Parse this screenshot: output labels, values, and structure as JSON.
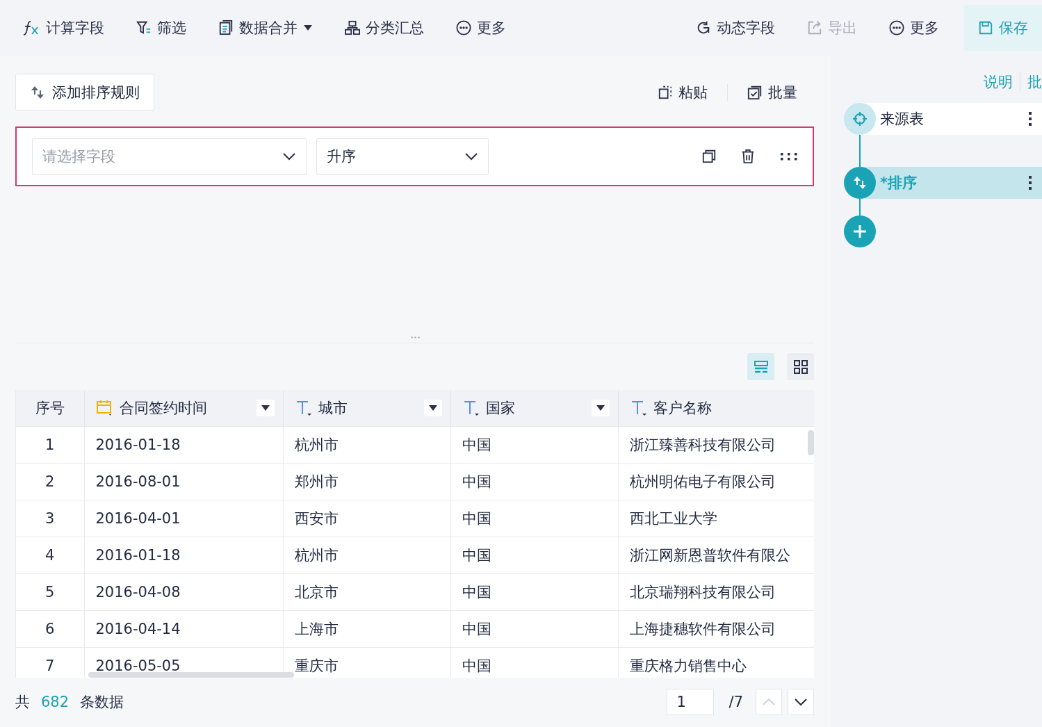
{
  "toolbar": {
    "left": [
      {
        "kind": "fx",
        "label": "计算字段"
      },
      {
        "kind": "filter",
        "label": "筛选"
      },
      {
        "kind": "merge",
        "label": "数据合并",
        "dropdown": true
      },
      {
        "kind": "group",
        "label": "分类汇总"
      },
      {
        "kind": "more",
        "label": "更多"
      }
    ],
    "right": [
      {
        "kind": "dynamic",
        "label": "动态字段",
        "disabled": false,
        "selected": false
      },
      {
        "kind": "export",
        "label": "导出",
        "disabled": true,
        "selected": false
      },
      {
        "kind": "more",
        "label": "更多",
        "disabled": false,
        "selected": false
      },
      {
        "kind": "save",
        "label": "保存",
        "disabled": false,
        "selected": true
      }
    ]
  },
  "sort_panel": {
    "add_button": "添加排序规则",
    "actions": [
      {
        "kind": "paste",
        "label": "粘贴"
      },
      {
        "kind": "batch",
        "label": "批量"
      }
    ],
    "rule": {
      "field": {
        "placeholder": "请选择字段"
      },
      "order": {
        "value": "升序"
      }
    }
  },
  "view_toggle": [
    {
      "kind": "list",
      "selected": true
    },
    {
      "kind": "grid",
      "selected": false
    }
  ],
  "table": {
    "columns": [
      {
        "label": "序号"
      },
      {
        "label": "合同签约时间",
        "kind": "date"
      },
      {
        "label": "城市",
        "kind": "text"
      },
      {
        "label": "国家",
        "kind": "text"
      },
      {
        "label": "客户名称",
        "kind": "text"
      }
    ],
    "rows": [
      [
        "1",
        "2016-01-18",
        "杭州市",
        "中国",
        "浙江臻善科技有限公司"
      ],
      [
        "2",
        "2016-08-01",
        "郑州市",
        "中国",
        "杭州明佑电子有限公司"
      ],
      [
        "3",
        "2016-04-01",
        "西安市",
        "中国",
        "西北工业大学"
      ],
      [
        "4",
        "2016-01-18",
        "杭州市",
        "中国",
        "浙江网新恩普软件有限公"
      ],
      [
        "5",
        "2016-04-08",
        "北京市",
        "中国",
        "北京瑞翔科技有限公司"
      ],
      [
        "6",
        "2016-04-14",
        "上海市",
        "中国",
        "上海捷穗软件有限公司"
      ],
      [
        "7",
        "2016-05-05",
        "重庆市",
        "中国",
        "重庆格力销售中心"
      ]
    ]
  },
  "footer": {
    "prefix": "共",
    "count": "682",
    "suffix": "条数据",
    "page": "1",
    "total": "/7",
    "prev_disabled": true,
    "next_disabled": false
  },
  "flow": {
    "links": [
      "说明",
      "批"
    ],
    "nodes": [
      {
        "kind": "source",
        "label": "来源表",
        "selected": false
      },
      {
        "kind": "sort",
        "label": "*排序",
        "selected": true
      }
    ]
  }
}
